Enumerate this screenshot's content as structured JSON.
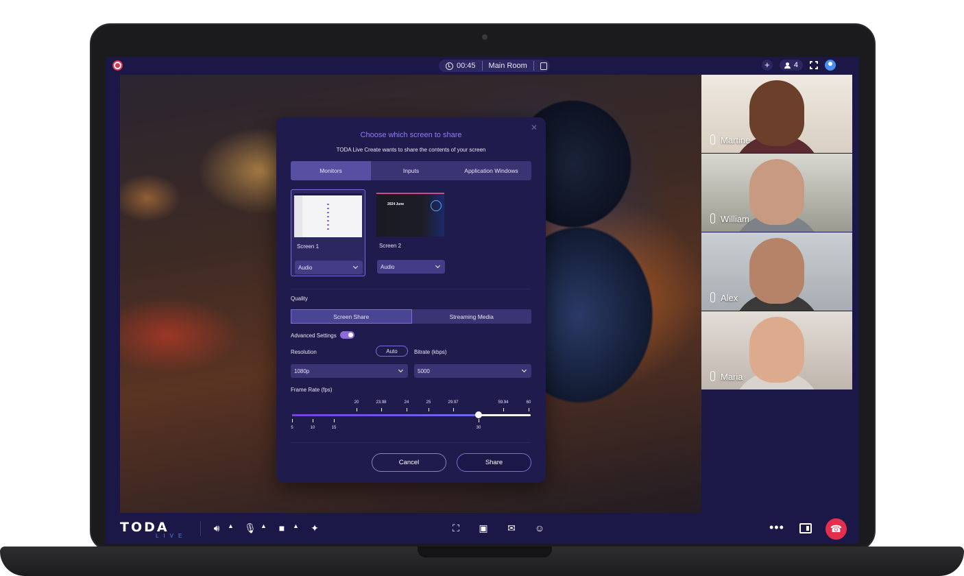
{
  "topbar": {
    "timer": "00:45",
    "room": "Main Room",
    "participant_count": "4"
  },
  "dialog": {
    "title": "Choose which screen to share",
    "subtitle": "TODA Live Create wants to share the contents of your screen",
    "tabs": [
      "Monitors",
      "Inputs",
      "Application Windows"
    ],
    "screens": [
      {
        "label": "Screen 1",
        "audio": "Audio",
        "thumb_text": ""
      },
      {
        "label": "Screen 2",
        "audio": "Audio",
        "thumb_text": "2024 June"
      }
    ],
    "quality_label": "Quality",
    "quality_tabs": [
      "Screen Share",
      "Streaming Media"
    ],
    "advanced_label": "Advanced Settings",
    "advanced_enabled": true,
    "resolution_label": "Resolution",
    "auto_label": "Auto",
    "bitrate_label": "Bitrate (kbps)",
    "resolution_value": "1080p",
    "bitrate_value": "5000",
    "frame_rate_label": "Frame Rate (fps)",
    "frame_rate": {
      "top_ticks": [
        "20",
        "23.98",
        "24",
        "25",
        "29.97",
        "59.94",
        "60"
      ],
      "bottom_ticks": [
        "5",
        "10",
        "15",
        "30"
      ],
      "selected": "30"
    },
    "cancel_label": "Cancel",
    "share_label": "Share"
  },
  "participants": [
    {
      "name": "Martine"
    },
    {
      "name": "William"
    },
    {
      "name": "Alex"
    },
    {
      "name": "Maria"
    }
  ],
  "brand": {
    "logo_main": "TODA",
    "logo_sub": "LIVE"
  },
  "colors": {
    "accent": "#8c6cd8",
    "background": "#1b1746",
    "danger": "#e0304e"
  }
}
